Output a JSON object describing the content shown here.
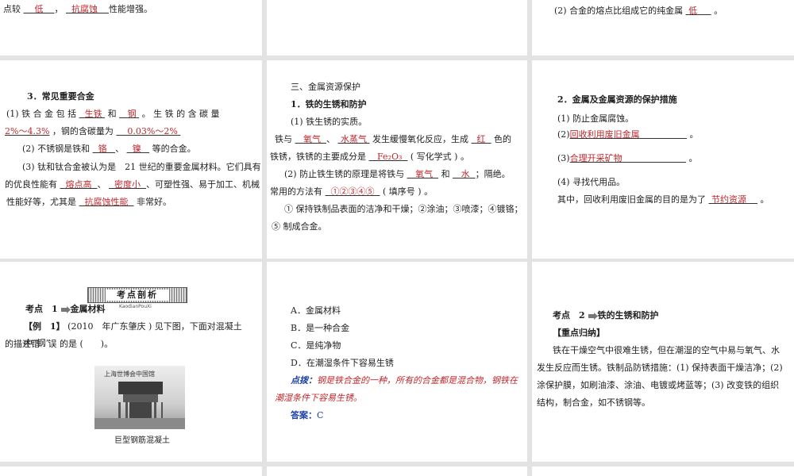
{
  "s1": {
    "l1_pre": "点较",
    "l1_a1": "低",
    "l1_sep": "，",
    "l1_a2": "抗腐蚀",
    "l1_post": "性能增强。"
  },
  "s3": {
    "l1_pre": "(2) 合金的熔点比组成它的纯金属",
    "l1_a": "低",
    "l1_post": "。"
  },
  "s4": {
    "title": "3．常见重要合金",
    "l1_pre": "(1) 铁 合 金 包 括",
    "l1_a1": "生铁",
    "l1_mid": "和",
    "l1_a2": "钢",
    "l1_post": "。 生 铁 的 含 碳 量",
    "l2_a": "2%～4.3%",
    "l2_mid": "，钢的含碳量为",
    "l2_b": "0.03%～2%",
    "l3_pre": "(2) 不锈钢是铁和",
    "l3_a1": "铬",
    "l3_sep": "、",
    "l3_a2": "镍",
    "l3_post": "等的合金。",
    "l4": "(3) 钛和钛合金被认为是　21 世纪的重要金属材料。它们具有",
    "l5_pre": "的优良性能有",
    "l5_a1": "熔点高",
    "l5_sep": "、",
    "l5_a2": "密度小",
    "l5_post": "、可塑性强、易于加工、机械",
    "l6_pre": "性能好等，尤其是",
    "l6_a": "抗腐蚀性能",
    "l6_post": "非常好。"
  },
  "s5": {
    "title": "三、金属资源保护",
    "sub": "1．铁的生锈和防护",
    "l1": "(1) 铁生锈的实质。",
    "l2_pre": "铁与",
    "l2_a1": "氧气",
    "l2_sep": "、",
    "l2_a2": "水蒸气",
    "l2_mid": "发生缓慢氧化反应，生成",
    "l2_a3": "红",
    "l2_post": "色的",
    "l3_pre": "铁锈，铁锈的主要成分是",
    "l3_a": "Fe₂O₃",
    "l3_post": "( 写化学式 ) 。",
    "l4_pre": "(2) 防止铁生锈的原理是将铁与",
    "l4_a1": "氧气",
    "l4_mid": "和",
    "l4_a2": "水",
    "l4_post": "；隔绝。",
    "l5_pre": "常用的方法有",
    "l5_a": "①②③④⑤",
    "l5_post": "( 填序号 ) 。",
    "l6": "① 保持铁制品表面的洁净和干燥；②涂油；③喷漆；④镀铬；",
    "l7": "⑤ 制成合金。"
  },
  "s6": {
    "title": "2．金属及金属资源的保护措施",
    "l1": "(1) 防止金属腐蚀。",
    "l2_pre": "(2)",
    "l2_a": "回收利用废旧金属",
    "l2_post": "。",
    "l3_pre": "(3)",
    "l3_a": "合理开采矿物",
    "l3_post": "。",
    "l4": "(4) 寻找代用品。",
    "l5_pre": "其中，回收利用废旧金属的目的是为了",
    "l5_a": "节约资源",
    "l5_post": "。"
  },
  "s7": {
    "banner": "考点剖析",
    "banner_sub": "KaodianPouXi",
    "k_pre": "考点　1",
    "k_post": "金属材料",
    "ex_label": "【例　1】",
    "ex_text": "(2010　年广东肇庆 ) 见下图，下面对混凝土中“钢”",
    "ex_text2": "的描述错 . 误 的是 (　　)。",
    "img_title": "上海世博会中国馆",
    "caption": "巨型钢筋混凝土"
  },
  "s8": {
    "a": "A．金属材料",
    "b": "B．是一种合金",
    "c": "C．是纯净物",
    "d": "D．在潮湿条件下容易生锈",
    "tip_label": "点拨：",
    "tip_text": "钢是铁合金的一种，所有的合金都是混合物，钢铁在",
    "tip_text2": "潮湿条件下容易生锈。",
    "ans_label": "答案：",
    "ans": "C"
  },
  "s9": {
    "k_pre": "考点　2",
    "k_post": "铁的生锈和防护",
    "sum": "【重点归纳】",
    "p1": "铁在干燥空气中很难生锈，但在潮湿的空气中易与氧气、水",
    "p2": "发生反应而生锈。铁制品防锈措施：(1) 保持表面干燥洁净；(2)",
    "p3": "涂保护膜，如刷油漆、涂油、电镀或烤蓝等；(3) 改变铁的组织",
    "p4": "结构，制合金，如不锈钢等。"
  },
  "colors": {
    "answer": "#c0282d",
    "answer_blue": "#1a3ea8",
    "gap": "#e3e3e3"
  }
}
